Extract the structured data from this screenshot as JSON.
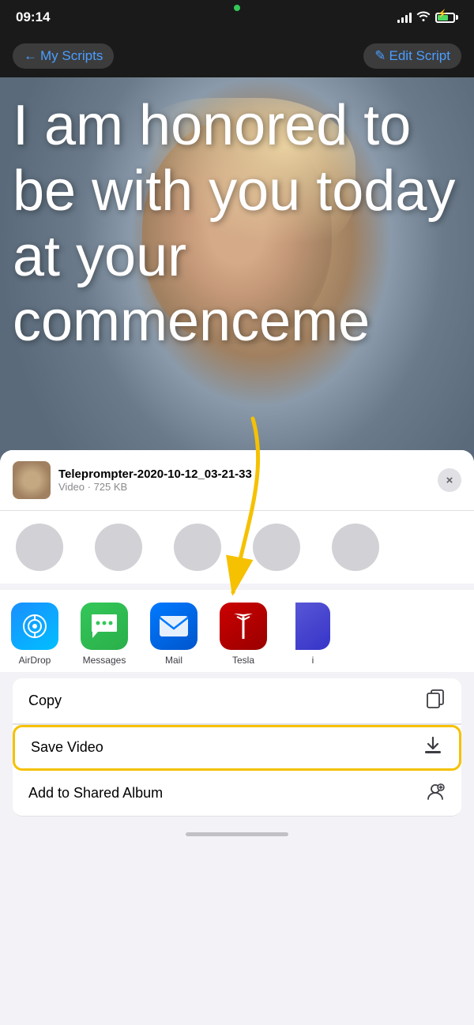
{
  "statusBar": {
    "time": "09:14",
    "greenDotVisible": true
  },
  "navBar": {
    "backLabel": "My Scripts",
    "backIcon": "←",
    "editLabel": "Edit Script",
    "editIcon": "✎"
  },
  "scriptText": "I am honored to be with you today at your commenceme",
  "shareSheet": {
    "fileName": "Teleprompter-2020-10-12_03-21-33",
    "fileType": "Video",
    "fileSize": "725 KB",
    "closeLabel": "×",
    "people": [],
    "apps": [
      {
        "id": "airdrop",
        "label": "AirDrop",
        "cssClass": "app-airdrop"
      },
      {
        "id": "messages",
        "label": "Messages",
        "cssClass": "app-messages"
      },
      {
        "id": "mail",
        "label": "Mail",
        "cssClass": "app-mail"
      },
      {
        "id": "tesla",
        "label": "Tesla",
        "cssClass": "app-tesla"
      }
    ],
    "actions": [
      {
        "id": "copy",
        "label": "Copy",
        "icon": "⧉"
      },
      {
        "id": "save-video",
        "label": "Save Video",
        "icon": "⬇",
        "highlighted": true
      },
      {
        "id": "add-shared-album",
        "label": "Add to Shared Album",
        "icon": "👤"
      }
    ]
  }
}
